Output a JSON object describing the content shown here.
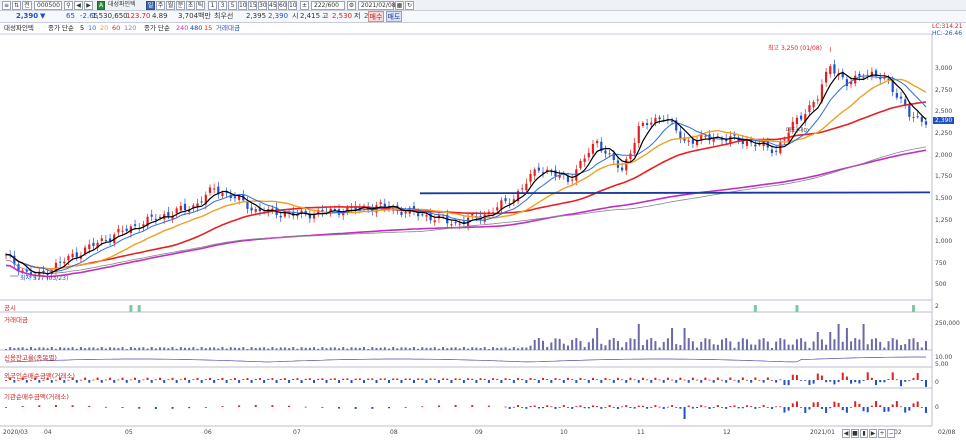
{
  "toolbar": {
    "code": "000500",
    "name": "대성파인텍",
    "periods": [
      "일",
      "주",
      "월",
      "분",
      "초",
      "틱"
    ],
    "minute_steps": [
      "1",
      "3",
      "5",
      "10",
      "15",
      "30",
      "45",
      "60",
      "10"
    ],
    "count": "222/600",
    "date": "2021/02/08",
    "buy_label": "매수",
    "sell_label": "매도"
  },
  "quote": {
    "price": "2,390",
    "change": "65",
    "change_pct": "-2.65",
    "volume": "1,530,650",
    "vol_pct": "123.70",
    "turnover_pct": "4.89",
    "amount": "3,704백만",
    "high_label": "최우선",
    "ask": "2,395",
    "bid": "2,390",
    "open_label": "시",
    "open": "2,415",
    "hi_label": "고",
    "high": "2,530",
    "lo_label": "저",
    "low": "2,375"
  },
  "legend": {
    "stock": "대성파인텍",
    "ma_label": "종가 단순",
    "ma_periods": [
      "5",
      "10",
      "20",
      "60",
      "120"
    ],
    "ma_long_label": "종가 단순",
    "ma_long_periods": [
      "240",
      "480",
      "15"
    ],
    "extra": "거래대금",
    "right_top": "LC:314.21",
    "right_top2": "HC:-26.46"
  },
  "annotations": {
    "high": "최고 3,250 (01/08)",
    "low": "최저 577 (03/23)",
    "mid": "매도(대0)"
  },
  "price_axis": [
    "3,000",
    "2,750",
    "2,500",
    "2,250",
    "2,000",
    "1,750",
    "1,500",
    "1,250",
    "1,000",
    "750",
    "500"
  ],
  "price_tag": "2,390",
  "panels": {
    "p1": "공시",
    "p2": "거래대금",
    "p3": "신용잔고율(종목별)",
    "p4": "외국인순매수금액(거래소)",
    "p5": "기관순매수금액(거래소)"
  },
  "panel_axis": {
    "p1": "2",
    "p2": "250,000",
    "p3a": "10.00",
    "p3b": "5.00",
    "p4": "0",
    "p5": "0"
  },
  "dates": [
    "2020/03",
    "04",
    "05",
    "06",
    "07",
    "08",
    "09",
    "10",
    "11",
    "12",
    "2021/01",
    "02",
    "02/08"
  ],
  "colors": {
    "up": "#e02020",
    "down": "#2050c8",
    "ma5": "#000000",
    "ma10": "#2a6fe0",
    "ma20": "#f0a020",
    "ma60": "#e82020",
    "ma120": "#888888",
    "ma240": "#c030c0",
    "ma480": "#1a3a9a",
    "volume": "#6a6aa8"
  }
}
